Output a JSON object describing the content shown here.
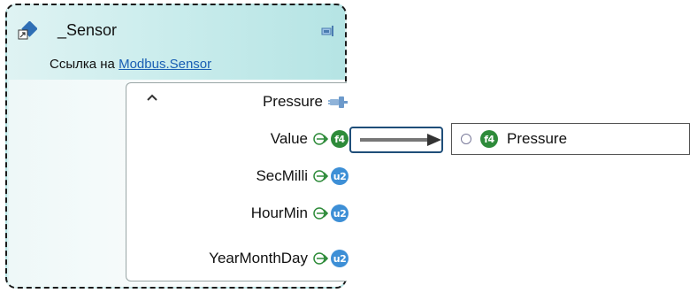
{
  "node": {
    "title": "_Sensor",
    "reference_prefix": "Ссылка на",
    "reference_link": "Modbus.Sensor",
    "group": {
      "name": "Pressure",
      "ports": [
        {
          "label": "Value",
          "type": "f4",
          "badge_color": "#2e8b3a"
        },
        {
          "label": "SecMilli",
          "type": "u2",
          "badge_color": "#3d8fd6"
        },
        {
          "label": "HourMin",
          "type": "u2",
          "badge_color": "#3d8fd6"
        },
        {
          "label": "YearMonthDay",
          "type": "u2",
          "badge_color": "#3d8fd6"
        }
      ]
    }
  },
  "target": {
    "type": "f4",
    "label": "Pressure"
  },
  "icons": {
    "node_icon": "component-shortcut-icon",
    "pin": "pin-icon",
    "group_connector": "plug-icon",
    "port_arrow": "arrow-right-circle-icon"
  }
}
